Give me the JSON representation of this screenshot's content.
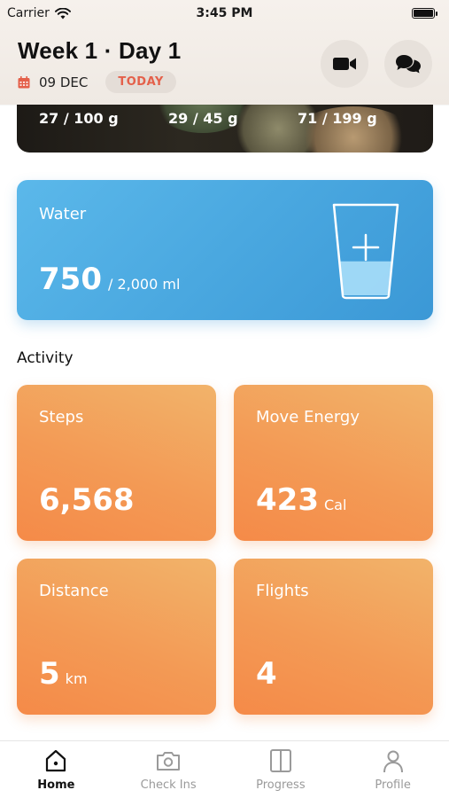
{
  "status_bar": {
    "carrier": "Carrier",
    "time": "3:45 PM"
  },
  "header": {
    "title": "Week 1 · Day 1",
    "date": "09 DEC",
    "today_label": "TODAY",
    "video_icon": "video-camera-icon",
    "chat_icon": "chat-bubbles-icon"
  },
  "nutrition": {
    "items": [
      {
        "value": "27 / 100 g"
      },
      {
        "value": "29 / 45 g"
      },
      {
        "value": "71 / 199 g"
      }
    ]
  },
  "water": {
    "label": "Water",
    "value": "750",
    "goal": "/  2,000 ml",
    "icon": "water-glass-plus-icon",
    "fill_fraction": 0.375
  },
  "activity": {
    "title": "Activity",
    "cards": [
      {
        "label": "Steps",
        "value": "6,568",
        "unit": ""
      },
      {
        "label": "Move Energy",
        "value": "423",
        "unit": "Cal"
      },
      {
        "label": "Distance",
        "value": "5",
        "unit": "km"
      },
      {
        "label": "Flights",
        "value": "4",
        "unit": ""
      }
    ]
  },
  "tabs": [
    {
      "label": "Home",
      "icon": "home-icon",
      "active": true
    },
    {
      "label": "Check Ins",
      "icon": "camera-icon",
      "active": false
    },
    {
      "label": "Progress",
      "icon": "split-panel-icon",
      "active": false
    },
    {
      "label": "Profile",
      "icon": "person-icon",
      "active": false
    }
  ],
  "colors": {
    "water_card": "#4aa8e0",
    "activity_card": "#f39a55",
    "today_text": "#e4604a",
    "calendar_icon": "#e4604a"
  }
}
